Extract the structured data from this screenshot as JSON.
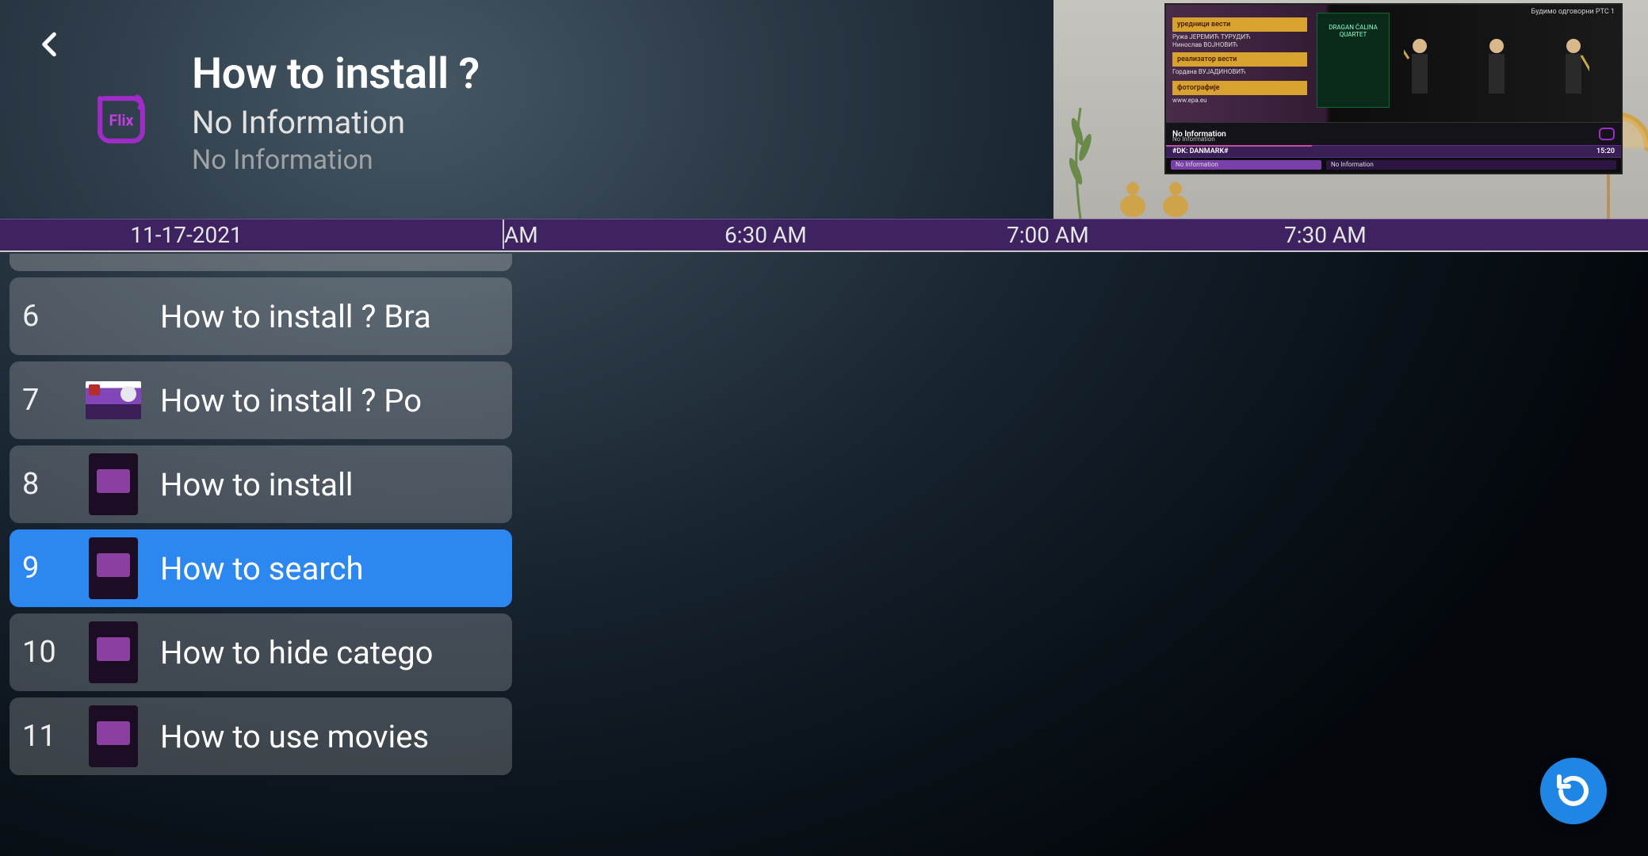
{
  "header": {
    "title": "How to install ?",
    "subtitle": "No Information",
    "subtext": "No Information"
  },
  "preview": {
    "top_right": "Будимо одговорни РТС 1",
    "credits": {
      "c1": "уредници вести",
      "s1": "Ружа ЈЕРЕМИЋ ТУРУДИЋ\nНинослав ВОЈНОВИЋ",
      "c2": "реализатор вести",
      "s2": "Гордана ВУЈАДИНОВИЋ",
      "c3": "фотографије",
      "s3": "www.epa.eu"
    },
    "poster_text": "DRAGAN ĆALINA QUARTET",
    "osd": {
      "line1": "No Information",
      "line2": "No Information",
      "channel_tag": "#DK: DANMARK#",
      "channel_time": "15:20",
      "segA": "No Information",
      "segB": "No Information"
    }
  },
  "timeline": {
    "date": "11-17-2021",
    "t0": "AM",
    "t1": "6:30 AM",
    "t2": "7:00 AM",
    "t3": "7:30 AM"
  },
  "channels": [
    {
      "num": "6",
      "label": "How to install ? Bra",
      "thumb": "none",
      "selected": false
    },
    {
      "num": "7",
      "label": "How to install ?  Po",
      "thumb": "card",
      "selected": false
    },
    {
      "num": "8",
      "label": "How to install",
      "thumb": "app",
      "selected": false
    },
    {
      "num": "9",
      "label": "How to search",
      "thumb": "app",
      "selected": true
    },
    {
      "num": "10",
      "label": "How to hide catego",
      "thumb": "app",
      "selected": false
    },
    {
      "num": "11",
      "label": "How to use movies",
      "thumb": "app",
      "selected": false
    }
  ]
}
